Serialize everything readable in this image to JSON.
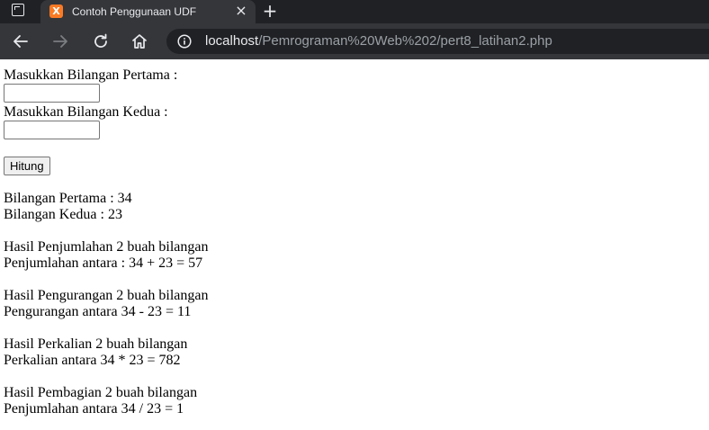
{
  "browser": {
    "tab": {
      "favicon_text": "X",
      "title": "Contoh Penggunaan UDF",
      "close_symbol": "×"
    },
    "new_tab_symbol": "+",
    "address": {
      "host": "localhost",
      "path": "/Pemrograman%20Web%202/pert8_latihan2.php"
    },
    "icons": [
      "window-menu-icon",
      "back-icon",
      "forward-icon",
      "reload-icon",
      "home-icon",
      "info-icon"
    ]
  },
  "form": {
    "label_first": "Masukkan Bilangan Pertama :",
    "value_first": "",
    "label_second": "Masukkan Bilangan Kedua :",
    "value_second": "",
    "submit_label": "Hitung"
  },
  "results": {
    "first_number": "Bilangan Pertama : 34",
    "second_number": "Bilangan Kedua : 23",
    "add_heading": "Hasil Penjumlahan 2 buah bilangan",
    "add_result": "Penjumlahan antara : 34 + 23 = 57",
    "sub_heading": "Hasil Pengurangan 2 buah bilangan",
    "sub_result": "Pengurangan antara 34 - 23 = 11",
    "mul_heading": "Hasil Perkalian 2 buah bilangan",
    "mul_result": "Perkalian antara 34 * 23 = 782",
    "div_heading": "Hasil Pembagian 2 buah bilangan",
    "div_result": "Penjumlahan antara 34 / 23 = 1"
  }
}
